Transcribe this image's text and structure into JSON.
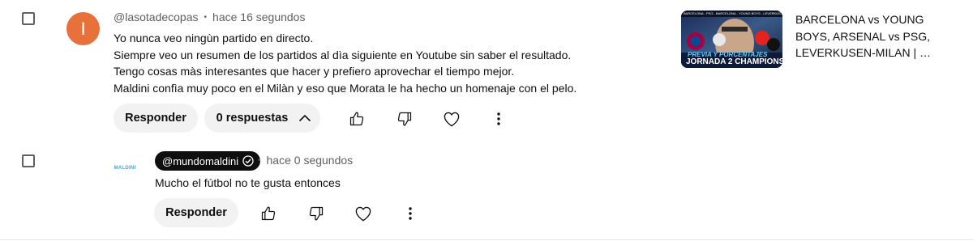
{
  "comments": [
    {
      "author": "@lasotadecopas",
      "avatar_letter": "I",
      "time": "hace 16 segundos",
      "lines": [
        "Yo nunca veo ningùn partido en directo.",
        "Siempre veo un resumen de los partidos al dìa siguiente en Youtube sin saber el resultado.",
        "Tengo cosas màs interesantes que hacer y prefiero aprovechar el tiempo mejor.",
        "Maldini confìa muy poco en el Milàn y eso que Morata le ha hecho un homenaje con el pelo."
      ],
      "reply_label": "Responder",
      "replies_label": "0 respuestas"
    },
    {
      "author": "@mundomaldini",
      "avatar_text": "MALDINI",
      "time": "hace 0 segundos",
      "lines": [
        "Mucho el fútbol no te gusta entonces"
      ],
      "reply_label": "Responder"
    }
  ],
  "video": {
    "title": "BARCELONA vs YOUNG BOYS, ARSENAL vs PSG, LEVERKUSEN-MILAN | …",
    "thumbnail": {
      "top_caption": "BARCELONA - PSG - BARCELONA - YOUNG BOYS - LEVERKUSEN - MILAN",
      "subtitle": "PREVIA Y PORCENTAJES",
      "headline": "JORNADA 2 CHAMPIONS"
    }
  },
  "icons": {
    "like": "thumbs-up-icon",
    "dislike": "thumbs-down-icon",
    "heart": "heart-icon",
    "more": "more-vertical-icon",
    "chevron": "chevron-up-icon",
    "verified": "verified-check-icon"
  },
  "colors": {
    "avatar": "#e7703b",
    "pill_bg": "#f2f2f2",
    "handle_chip": "#0f0f0f",
    "meta_text": "#606060"
  }
}
